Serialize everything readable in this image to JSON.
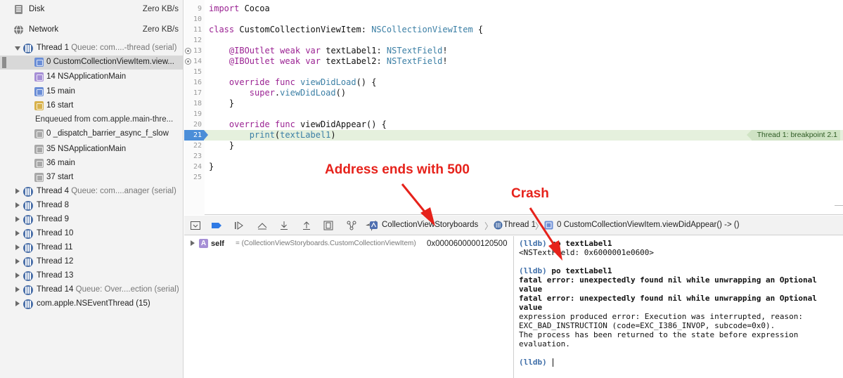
{
  "navigator": {
    "disk": {
      "label": "Disk",
      "value": "Zero KB/s"
    },
    "network": {
      "label": "Network",
      "value": "Zero KB/s"
    },
    "threads": [
      {
        "name": "Thread 1",
        "queue": "Queue: com....-thread (serial)",
        "expanded": true,
        "frames": [
          {
            "label": "0 CustomCollectionViewItem.view...",
            "kind": "user",
            "selected": true
          },
          {
            "label": "14 NSApplicationMain",
            "kind": "main"
          },
          {
            "label": "15 main",
            "kind": "user"
          },
          {
            "label": "16 start",
            "kind": "start"
          },
          {
            "label": "Enqueued from com.apple.main-thre...",
            "kind": "enqueued"
          },
          {
            "label": "0 _dispatch_barrier_async_f_slow",
            "kind": "sys"
          },
          {
            "label": "35 NSApplicationMain",
            "kind": "sys"
          },
          {
            "label": "36 main",
            "kind": "sys"
          },
          {
            "label": "37 start",
            "kind": "sys"
          }
        ]
      },
      {
        "name": "Thread 4",
        "queue": "Queue: com....anager (serial)"
      },
      {
        "name": "Thread 8",
        "queue": ""
      },
      {
        "name": "Thread 9",
        "queue": ""
      },
      {
        "name": "Thread 10",
        "queue": ""
      },
      {
        "name": "Thread 11",
        "queue": ""
      },
      {
        "name": "Thread 12",
        "queue": ""
      },
      {
        "name": "Thread 13",
        "queue": ""
      },
      {
        "name": "Thread 14",
        "queue": "Queue: Over....ection (serial)"
      },
      {
        "name": "com.apple.NSEventThread (15)",
        "queue": ""
      }
    ]
  },
  "editor": {
    "lines": [
      {
        "n": "9",
        "code": "import Cocoa"
      },
      {
        "n": "10",
        "code": ""
      },
      {
        "n": "11",
        "code": "class CustomCollectionViewItem: NSCollectionViewItem {"
      },
      {
        "n": "12",
        "code": ""
      },
      {
        "n": "13",
        "code": "    @IBOutlet weak var textLabel1: NSTextField!",
        "outlet": true
      },
      {
        "n": "14",
        "code": "    @IBOutlet weak var textLabel2: NSTextField!",
        "outlet": true
      },
      {
        "n": "15",
        "code": ""
      },
      {
        "n": "16",
        "code": "    override func viewDidLoad() {"
      },
      {
        "n": "17",
        "code": "        super.viewDidLoad()"
      },
      {
        "n": "18",
        "code": "    }"
      },
      {
        "n": "19",
        "code": ""
      },
      {
        "n": "20",
        "code": "    override func viewDidAppear() {"
      },
      {
        "n": "21",
        "code": "        print(textLabel1)",
        "current": true
      },
      {
        "n": "22",
        "code": "    }"
      },
      {
        "n": "23",
        "code": ""
      },
      {
        "n": "24",
        "code": "}"
      },
      {
        "n": "25",
        "code": ""
      }
    ],
    "breakpoint_badge": "Thread 1: breakpoint 2.1"
  },
  "debug_bar": {
    "crumbs": [
      "CollectionViewStoryboards",
      "Thread 1",
      "0 CustomCollectionViewItem.viewDidAppear() -> ()"
    ]
  },
  "variables": {
    "name": "self",
    "type": "= (CollectionViewStoryboards.CustomCollectionViewItem)",
    "address": "0x0000600000120500"
  },
  "console": {
    "lines": [
      {
        "kind": "cmd",
        "prompt": "(lldb)",
        "text": "po textLabel1"
      },
      {
        "kind": "out",
        "text": "<NSTextField: 0x6000001e0600>"
      },
      {
        "kind": "blank",
        "text": ""
      },
      {
        "kind": "cmd",
        "prompt": "(lldb)",
        "text": "po textLabel1"
      },
      {
        "kind": "err",
        "text": "fatal error: unexpectedly found nil while unwrapping an Optional value"
      },
      {
        "kind": "err",
        "text": "fatal error: unexpectedly found nil while unwrapping an Optional value"
      },
      {
        "kind": "out",
        "text": "expression produced error: Execution was interrupted, reason: EXC_BAD_INSTRUCTION (code=EXC_I386_INVOP, subcode=0x0)."
      },
      {
        "kind": "out",
        "text": "The process has been returned to the state before expression evaluation."
      },
      {
        "kind": "blank",
        "text": ""
      },
      {
        "kind": "prompt",
        "prompt": "(lldb)",
        "text": ""
      }
    ]
  },
  "annotations": {
    "address_note": "Address ends with 500",
    "crash_note": "Crash",
    "color": "#e6221b"
  },
  "colors": {
    "accent": "#4b8ed8",
    "current_line": "#e5f0dd",
    "keyword": "#9b2393",
    "type": "#3b7fa5"
  }
}
